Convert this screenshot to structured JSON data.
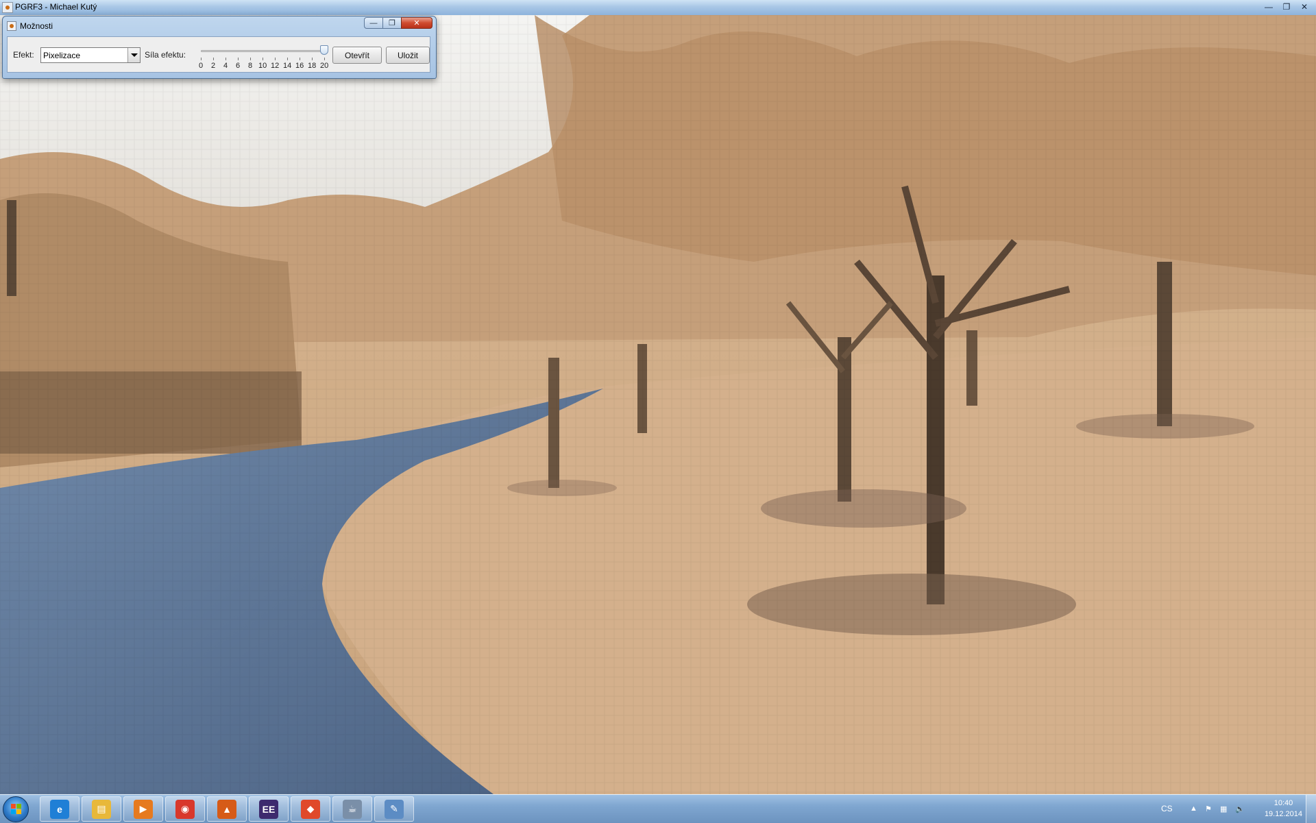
{
  "main_window": {
    "title": "PGRF3 - Michael Kutý",
    "controls": {
      "minimize": "—",
      "maximize": "❐",
      "close": "✕"
    }
  },
  "dialog": {
    "title": "Možnosti",
    "controls": {
      "minimize": "—",
      "maximize": "❐",
      "close": "✕"
    },
    "effect_label": "Efekt:",
    "effect_value": "Pixelizace",
    "strength_label": "Síla efektu:",
    "slider": {
      "value": 20,
      "min": 0,
      "max": 20,
      "tick_labels": [
        "0",
        "2",
        "4",
        "6",
        "8",
        "10",
        "12",
        "14",
        "16",
        "18",
        "20"
      ]
    },
    "open_button": "Otevřít",
    "save_button": "Uložit"
  },
  "taskbar": {
    "apps": [
      {
        "name": "internet-explorer",
        "glyph": "e",
        "color": "#1f7fd6"
      },
      {
        "name": "file-explorer",
        "glyph": "▤",
        "color": "#e8b83a"
      },
      {
        "name": "media-player",
        "glyph": "▶",
        "color": "#e67a1f"
      },
      {
        "name": "chrome",
        "glyph": "◉",
        "color": "#d8382c"
      },
      {
        "name": "matlab",
        "glyph": "▲",
        "color": "#d65b18"
      },
      {
        "name": "eclipse-javaee",
        "glyph": "EE",
        "color": "#3d2a6e"
      },
      {
        "name": "git",
        "glyph": "◆",
        "color": "#e0492a"
      },
      {
        "name": "java",
        "glyph": "☕",
        "color": "#7a8fa8"
      },
      {
        "name": "paint",
        "glyph": "✎",
        "color": "#5c8cc4"
      }
    ],
    "language": "CS",
    "clock": {
      "time": "10:40",
      "date": "19.12.2014"
    }
  }
}
